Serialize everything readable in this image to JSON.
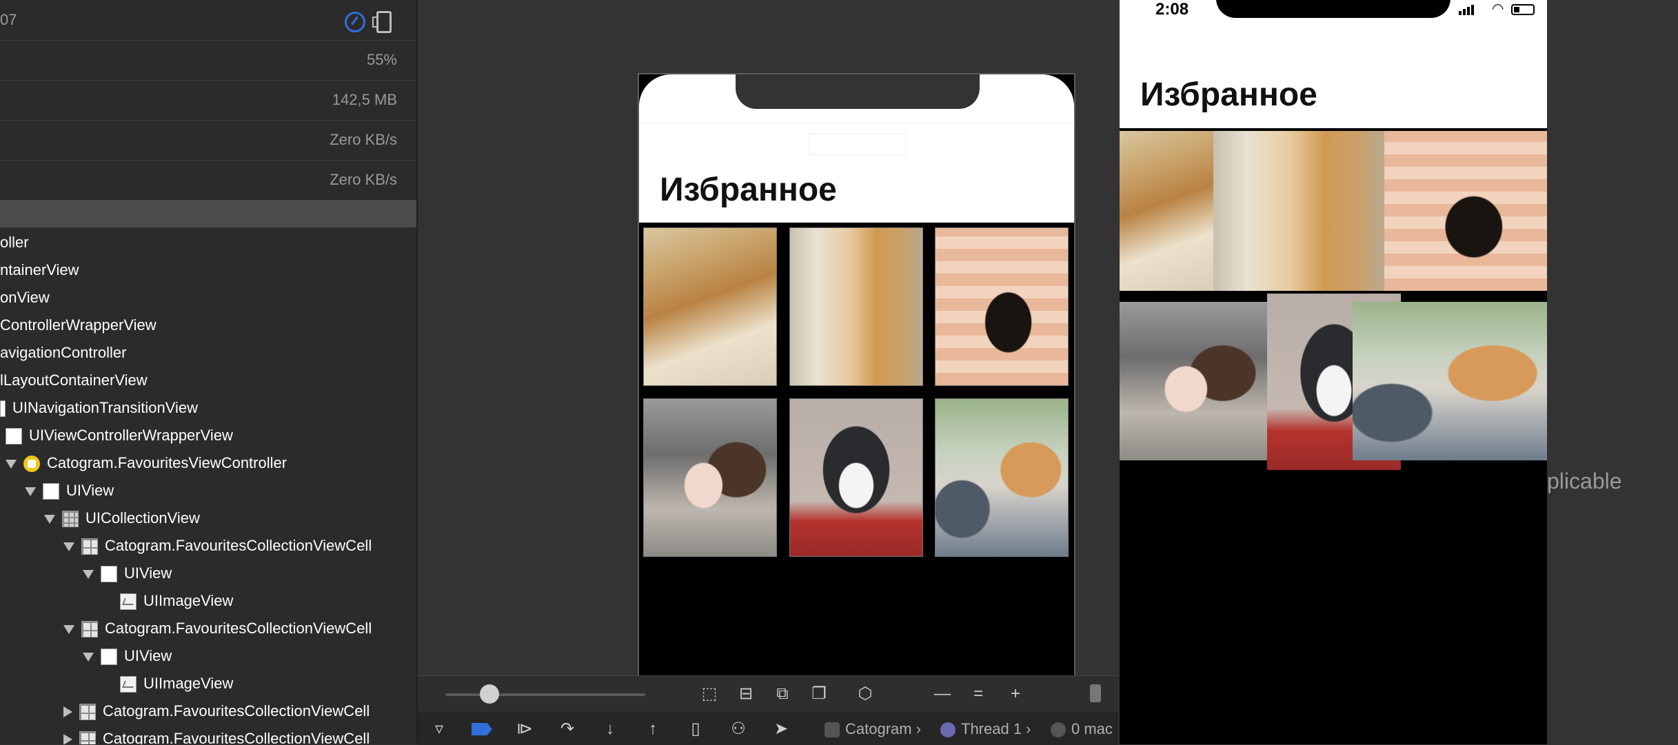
{
  "navigator": {
    "header_fragment": "07",
    "metrics": [
      {
        "value": "55%"
      },
      {
        "value": "142,5 MB"
      },
      {
        "value": "Zero KB/s"
      },
      {
        "value": "Zero KB/s"
      }
    ],
    "tree": [
      {
        "label": "oller",
        "indent": 0
      },
      {
        "label": "ntainerView",
        "indent": 0
      },
      {
        "label": "onView",
        "indent": 0
      },
      {
        "label": "ControllerWrapperView",
        "indent": 0
      },
      {
        "label": "avigationController",
        "indent": 0
      },
      {
        "label": "lLayoutContainerView",
        "indent": 0
      },
      {
        "label": "UINavigationTransitionView",
        "indent": 0
      },
      {
        "label": "UIViewControllerWrapperView",
        "indent": 0
      },
      {
        "label": "Catogram.FavouritesViewController",
        "indent": 0
      },
      {
        "label": "UIView",
        "indent": 0
      },
      {
        "label": "UICollectionView",
        "indent": 0
      },
      {
        "label": "Catogram.FavouritesCollectionViewCell",
        "indent": 0
      },
      {
        "label": "UIView",
        "indent": 0
      },
      {
        "label": "UIImageView",
        "indent": 0
      },
      {
        "label": "Catogram.FavouritesCollectionViewCell",
        "indent": 0
      },
      {
        "label": "UIView",
        "indent": 0
      },
      {
        "label": "UIImageView",
        "indent": 0
      },
      {
        "label": "Catogram.FavouritesCollectionViewCell",
        "indent": 0
      },
      {
        "label": "Catogram.FavouritesCollectionViewCell",
        "indent": 0
      }
    ]
  },
  "canvas": {
    "screen_title": "Избранное",
    "images": [
      "cat on book",
      "cat tail",
      "black cat with lights",
      "sleeping kittens",
      "black and white cat",
      "sleeping cat by phone"
    ]
  },
  "debug_bar": {
    "scheme": "Catogram",
    "thread": "Thread 1",
    "queue": "0 mac"
  },
  "simulator": {
    "time": "2:08",
    "screen_title": "Избранное"
  },
  "overlay_text": "plicable"
}
